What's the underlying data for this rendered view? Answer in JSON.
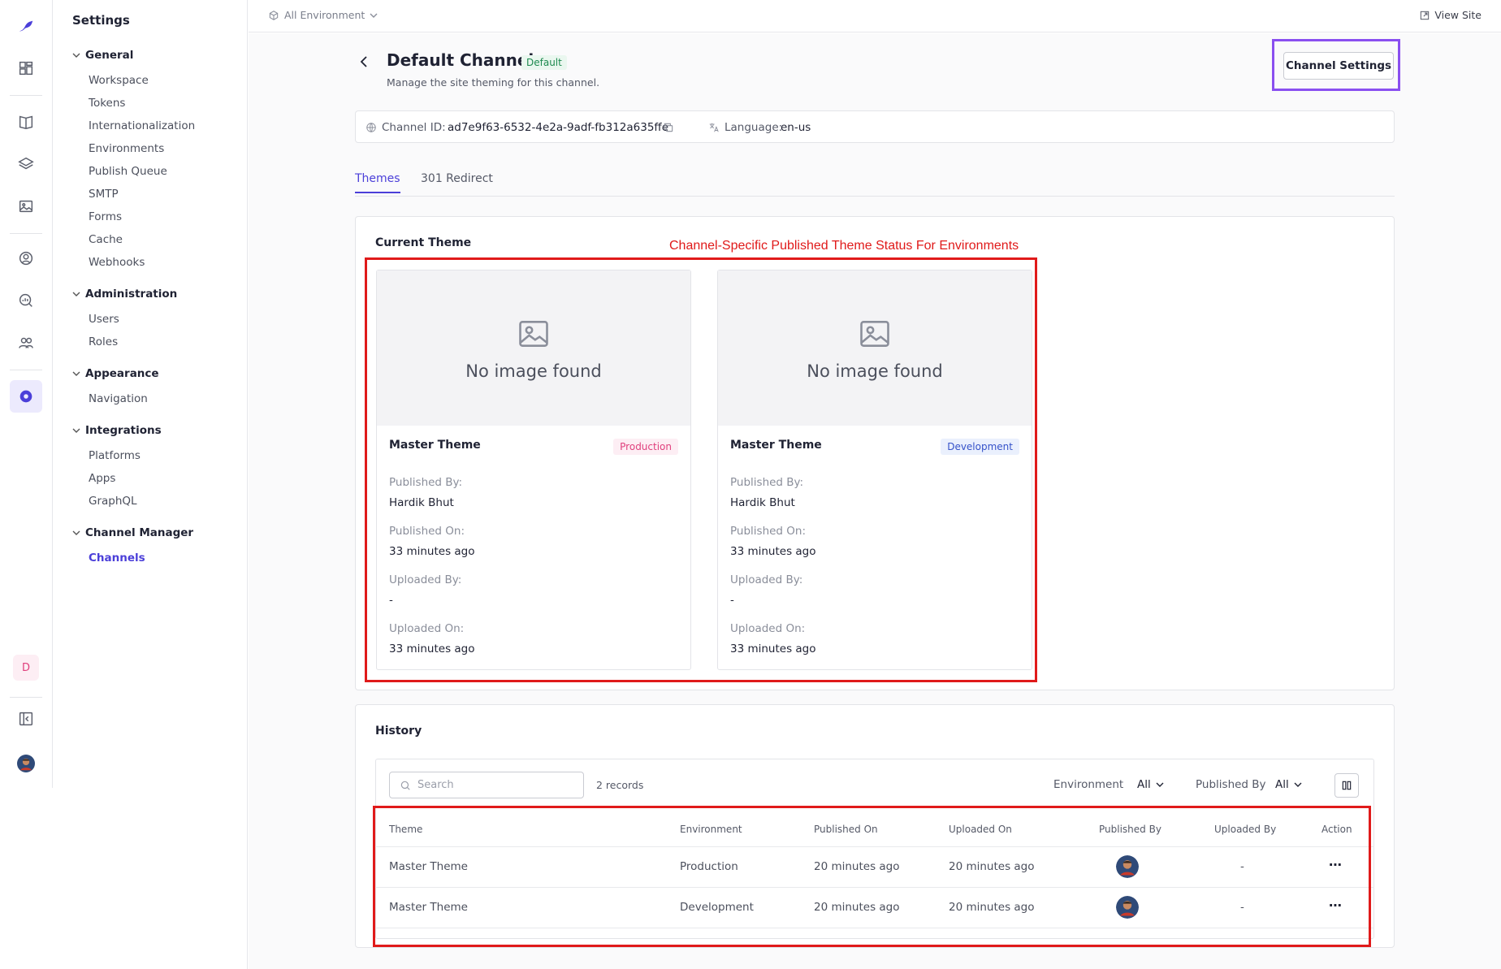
{
  "sidebar": {
    "title": "Settings",
    "groups": [
      {
        "label": "General",
        "items": [
          "Workspace",
          "Tokens",
          "Internationalization",
          "Environments",
          "Publish Queue",
          "SMTP",
          "Forms",
          "Cache",
          "Webhooks"
        ]
      },
      {
        "label": "Administration",
        "items": [
          "Users",
          "Roles"
        ]
      },
      {
        "label": "Appearance",
        "items": [
          "Navigation"
        ]
      },
      {
        "label": "Integrations",
        "items": [
          "Platforms",
          "Apps",
          "GraphQL"
        ]
      },
      {
        "label": "Channel Manager",
        "items": [
          "Channels"
        ]
      }
    ],
    "active_item": "Channels"
  },
  "rail": {
    "user_initial": "D"
  },
  "topbar": {
    "environment": "All Environment",
    "view_site": "View Site"
  },
  "header": {
    "title": "Default Channel",
    "badge": "Default",
    "subtitle": "Manage the site theming for this channel.",
    "settings_button": "Channel Settings"
  },
  "info": {
    "channel_id_label": "Channel ID:",
    "channel_id": "ad7e9f63-6532-4e2a-9adf-fb312a635ffe",
    "language_label": "Language:",
    "language": "en-us"
  },
  "tabs": [
    "Themes",
    "301 Redirect"
  ],
  "current_theme": {
    "title": "Current Theme",
    "annotation": "Channel-Specific Published Theme Status For Environments",
    "no_image": "No image found",
    "labels": {
      "published_by": "Published By:",
      "published_on": "Published On:",
      "uploaded_by": "Uploaded By:",
      "uploaded_on": "Uploaded On:"
    },
    "cards": [
      {
        "name": "Master Theme",
        "environment": "Production",
        "published_by": "Hardik Bhut",
        "published_on": "33 minutes ago",
        "uploaded_by": "-",
        "uploaded_on": "33 minutes ago"
      },
      {
        "name": "Master Theme",
        "environment": "Development",
        "published_by": "Hardik Bhut",
        "published_on": "33 minutes ago",
        "uploaded_by": "-",
        "uploaded_on": "33 minutes ago"
      }
    ]
  },
  "history": {
    "title": "History",
    "search_placeholder": "Search",
    "records": "2 records",
    "filters": [
      {
        "label": "Environment",
        "value": "All"
      },
      {
        "label": "Published By",
        "value": "All"
      }
    ],
    "columns": [
      "Theme",
      "Environment",
      "Published On",
      "Uploaded On",
      "Published By",
      "Uploaded By",
      "Action"
    ],
    "rows": [
      {
        "theme": "Master Theme",
        "environment": "Production",
        "published_on": "20 minutes ago",
        "uploaded_on": "20 minutes ago",
        "uploaded_by": "-",
        "action": "⋯"
      },
      {
        "theme": "Master Theme",
        "environment": "Development",
        "published_on": "20 minutes ago",
        "uploaded_on": "20 minutes ago",
        "uploaded_by": "-",
        "action": "⋯"
      }
    ]
  },
  "colors": {
    "accent": "#4b3fd9",
    "annotation_red": "#e01a1a",
    "highlight_purple": "#8a4ff0"
  }
}
